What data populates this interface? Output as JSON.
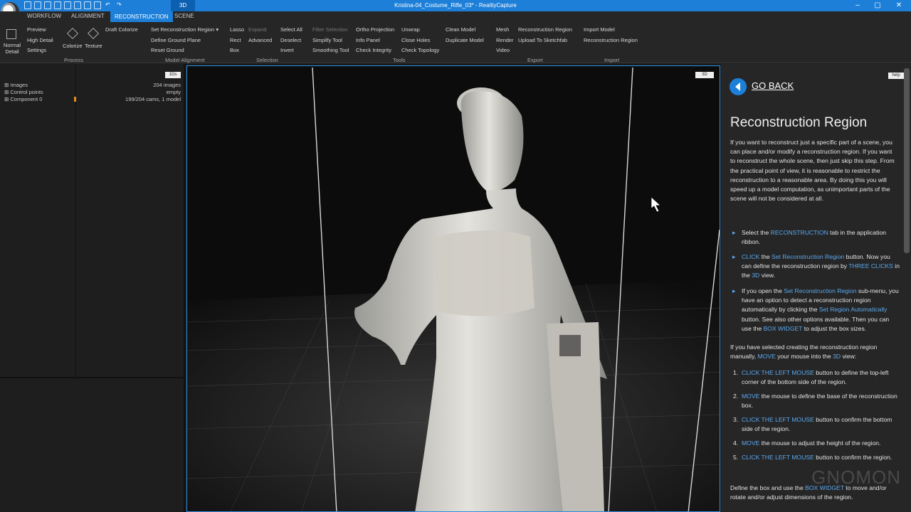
{
  "window": {
    "title": "Kristina-04_Costume_Rifle_03* - RealityCapture",
    "view_tab": "3D"
  },
  "tabs": [
    {
      "label": "WORKFLOW"
    },
    {
      "label": "ALIGNMENT"
    },
    {
      "label": "RECONSTRUCTION"
    },
    {
      "label": "SCENE"
    }
  ],
  "ribbon": {
    "normal_detail": "Normal Detail",
    "preview": "Preview",
    "high_detail": "High Detail",
    "settings": "Settings",
    "colorize": "Colorize",
    "texture": "Texture",
    "draft_colorize": "Draft Colorize",
    "set_reconstruction_region": "Set Reconstruction Region",
    "define_ground_plane": "Define Ground Plane",
    "reset_ground": "Reset Ground",
    "lasso": "Lasso",
    "rect": "Rect",
    "box": "Box",
    "expand": "Expand",
    "advanced": "Advanced",
    "select_all": "Select All",
    "deselect": "Deselect",
    "invert": "Invert",
    "filter_selection": "Filter Selection",
    "simplify_tool": "Simplify Tool",
    "smoothing_tool": "Smoothing Tool",
    "ortho_projection": "Ortho Projection",
    "info_panel": "Info Panel",
    "check_integrity": "Check Integrity",
    "unwrap": "Unwrap",
    "close_holes": "Close Holes",
    "check_topology": "Check Topology",
    "clean_model": "Clean Model",
    "duplicate_model": "Duplicate Model",
    "mesh": "Mesh",
    "render": "Render",
    "video": "Video",
    "export_reconstruction_region": "Reconstruction Region",
    "upload_sketchfab": "Upload To Sketchfab",
    "import_model": "Import Model",
    "import_reconstruction_region": "Reconstruction Region",
    "groups": {
      "process": "Process",
      "model_alignment": "Model Alignment",
      "selection": "Selection",
      "tools": "Tools",
      "export": "Export",
      "import": "Import"
    }
  },
  "panel": {
    "badge": "1Ds",
    "rows": [
      {
        "label": "Images",
        "value": "204 images"
      },
      {
        "label": "Control points",
        "value": "empty"
      },
      {
        "label": "Component 0",
        "value": "199/204 cams, 1 model"
      }
    ]
  },
  "viewport": {
    "badge": "3D"
  },
  "help": {
    "help_label": "help",
    "go_back": "GO BACK",
    "title": "Reconstruction Region",
    "intro": "If you want to reconstruct just a specific part of a scene, you can place and/or modify a reconstruction region. If you want to reconstruct the whole scene, then just skip this step. From the practical point of view, it is reasonable to restrict the reconstruction to a reasonable area. By doing this you will speed up a model computation, as unimportant parts of the scene will not be considered at all.",
    "b1": {
      "a": "Select the ",
      "h1": "RECONSTRUCTION",
      "b": " tab in the application ribbon."
    },
    "b2": {
      "h1": "CLICK",
      "a": " the ",
      "h2": "Set Reconstruction Region",
      "b": " button. Now you can define the reconstruction region by ",
      "h3": "THREE CLICKS",
      "c": " in the ",
      "h4": "3D",
      "d": " view."
    },
    "b3": {
      "a": "If you open the ",
      "h1": "Set Reconstruction Region",
      "b": " sub-menu, you have an option to detect a reconstruction region automatically by clicking the ",
      "h2": "Set Region Automatically",
      "c": " button. See also other options available. Then you can use the ",
      "h3": "BOX WIDGET",
      "d": " to adjust the box sizes."
    },
    "manual": {
      "a": "If you have selected creating the reconstruction region manually, ",
      "h1": "MOVE",
      "b": " your mouse into the ",
      "h2": "3D",
      "c": " view:"
    },
    "steps": [
      {
        "n": "1.",
        "h": "CLICK THE LEFT MOUSE",
        "t": " button to define the top-left corner of the bottom side of the region."
      },
      {
        "n": "2.",
        "h": "MOVE",
        "t": " the mouse to define the base of the reconstruction box."
      },
      {
        "n": "3.",
        "h": "CLICK THE LEFT MOUSE",
        "t": " button to confirm the bottom side of the region."
      },
      {
        "n": "4.",
        "h": "MOVE",
        "t": " the mouse to adjust the height of the region."
      },
      {
        "n": "5.",
        "h": "CLICK THE LEFT MOUSE",
        "t": " button to confirm the region."
      }
    ],
    "outro": {
      "a": "Define the box and use the ",
      "h1": "BOX WIDGET",
      "b": " to move and/or rotate and/or adjust dimensions of the region."
    },
    "watermark": "GNOMON"
  }
}
